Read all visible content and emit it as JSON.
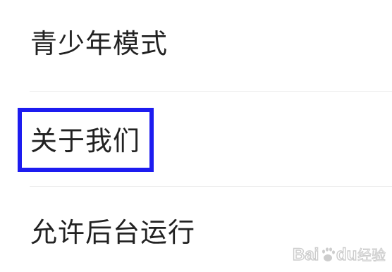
{
  "settings": {
    "items": [
      {
        "label": "青少年模式"
      },
      {
        "label": "关于我们"
      },
      {
        "label": "允许后台运行"
      }
    ]
  },
  "highlight": {
    "target": "关于我们",
    "color": "#1d1cf0"
  },
  "watermark": {
    "text": "Baidu经验",
    "icon": "baidu-paw-icon"
  }
}
